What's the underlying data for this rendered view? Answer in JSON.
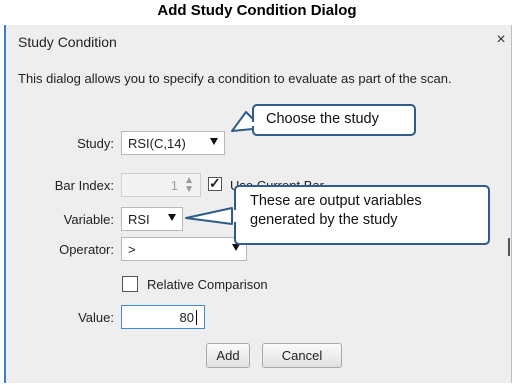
{
  "caption": "Add Study Condition Dialog",
  "dialog": {
    "title": "Study Condition",
    "close_glyph": "×",
    "description": "This dialog allows you to specify a condition to evaluate as part of the scan."
  },
  "form": {
    "study_label": "Study:",
    "study_value": "RSI(C,14)",
    "bar_index_label": "Bar Index:",
    "bar_index_value": "1",
    "use_current_bar_label": "Use Current Bar",
    "use_current_bar_checked": true,
    "variable_label": "Variable:",
    "variable_value": "RSI",
    "operator_label": "Operator:",
    "operator_value": ">",
    "relative_comparison_label": "Relative Comparison",
    "relative_comparison_checked": false,
    "value_label": "Value:",
    "value_value": "80"
  },
  "buttons": {
    "add": "Add",
    "cancel": "Cancel"
  },
  "callouts": {
    "study": "Choose the study",
    "variable": "These are output variables generated by the study"
  },
  "colors": {
    "accent": "#3b7fc4",
    "callout_border": "#2f5c8a",
    "dialog_bg": "#eeeeee"
  }
}
